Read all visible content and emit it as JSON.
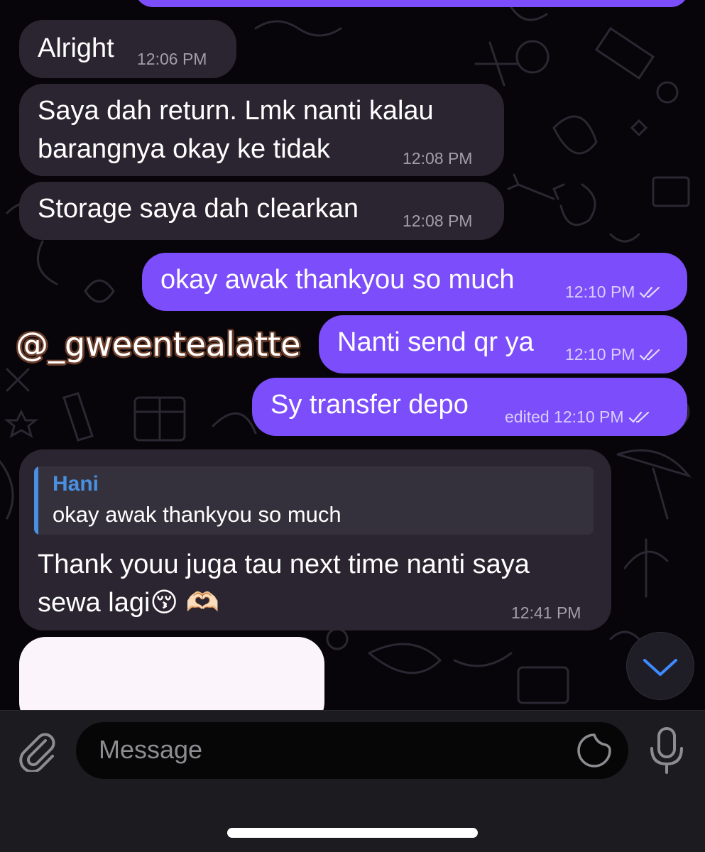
{
  "messages": [
    {
      "dir": "in",
      "text": "Alright",
      "time": "12:06 PM"
    },
    {
      "dir": "in",
      "lines": [
        "Saya dah return. Lmk nanti kalau",
        "barangnya okay ke tidak"
      ],
      "time": "12:08 PM"
    },
    {
      "dir": "in",
      "text": "Storage saya dah clearkan",
      "time": "12:08 PM"
    },
    {
      "dir": "out",
      "text": "okay awak thankyou so much",
      "time": "12:10 PM"
    },
    {
      "dir": "out",
      "text": "Nanti send qr ya",
      "time": "12:10 PM"
    },
    {
      "dir": "out",
      "text": "Sy transfer depo",
      "time": "edited 12:10 PM"
    },
    {
      "dir": "in",
      "reply": {
        "name": "Hani",
        "text": "okay awak thankyou so much"
      },
      "lines": [
        "Thank youu juga tau next time nanti saya",
        "sewa lagi😚 🫶🏻"
      ],
      "time": "12:41 PM"
    }
  ],
  "watermark": "@_gweentealatte",
  "composer": {
    "placeholder": "Message"
  },
  "icons": [
    "attach-icon",
    "sticker-icon",
    "microphone-icon",
    "chevron-down-icon",
    "double-check-icon"
  ],
  "colors": {
    "outgoing": "#7c4dfa",
    "incoming": "#2a2530",
    "reply_accent": "#4a90e2",
    "background": "#070509"
  }
}
